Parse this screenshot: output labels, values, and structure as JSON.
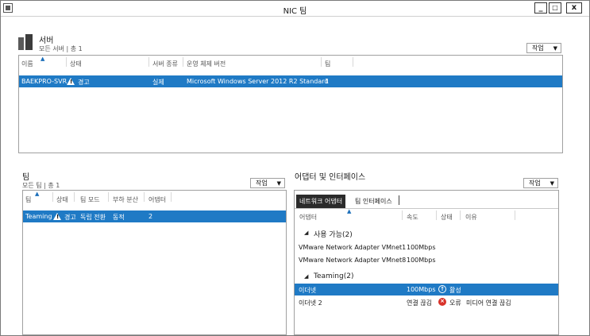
{
  "window": {
    "title": "NIC 팀",
    "min": "_",
    "max": "□",
    "close": "x"
  },
  "servers": {
    "title": "서버",
    "subtitle": "모든 서버 | 총 1",
    "tasks": "작업",
    "columns": [
      "이름",
      "상태",
      "서버 종류",
      "운영 체제 버전",
      "팀"
    ],
    "rows": [
      {
        "name": "BAEKPRO-SVR",
        "status": "경고",
        "type": "실제",
        "os": "Microsoft Windows Server 2012 R2 Standard",
        "teams": "1"
      }
    ]
  },
  "teams": {
    "title": "팀",
    "subtitle": "모든 팀 | 총 1",
    "tasks": "작업",
    "columns": [
      "팀",
      "상태",
      "팀 모드",
      "부하 분산",
      "어댑터"
    ],
    "rows": [
      {
        "team": "Teaming",
        "status": "경고",
        "mode": "독립 전환",
        "lb": "동적",
        "adapters": "2"
      }
    ]
  },
  "adapters": {
    "title": "어댑터 및 인터페이스",
    "tasks": "작업",
    "tabs": [
      "네트워크 어댑터",
      "팀 인터페이스"
    ],
    "columns": [
      "어댑터",
      "속도",
      "상태",
      "이유"
    ],
    "groups": [
      {
        "label": "사용 가능(2)",
        "rows": [
          {
            "adapter": "VMware Network Adapter VMnet1",
            "speed": "100Mbps",
            "status": "",
            "reason": ""
          },
          {
            "adapter": "VMware Network Adapter VMnet8",
            "speed": "100Mbps",
            "status": "",
            "reason": ""
          }
        ]
      },
      {
        "label": "Teaming(2)",
        "rows": [
          {
            "adapter": "이더넷",
            "speed": "100Mbps",
            "status": "활성",
            "reason": ""
          },
          {
            "adapter": "이더넷 2",
            "speed": "연결 끊김",
            "status": "오류",
            "reason": "미디어 연결 끊김"
          }
        ]
      }
    ]
  },
  "colors": {
    "selection": "#1f7ac5",
    "error": "#d9342b"
  },
  "icons": {
    "app": "nic-team-app-icon",
    "server_section": "server-icon",
    "warning": "warning-icon",
    "active": "arrow-up-circle-icon",
    "error": "error-x-circle-icon"
  }
}
